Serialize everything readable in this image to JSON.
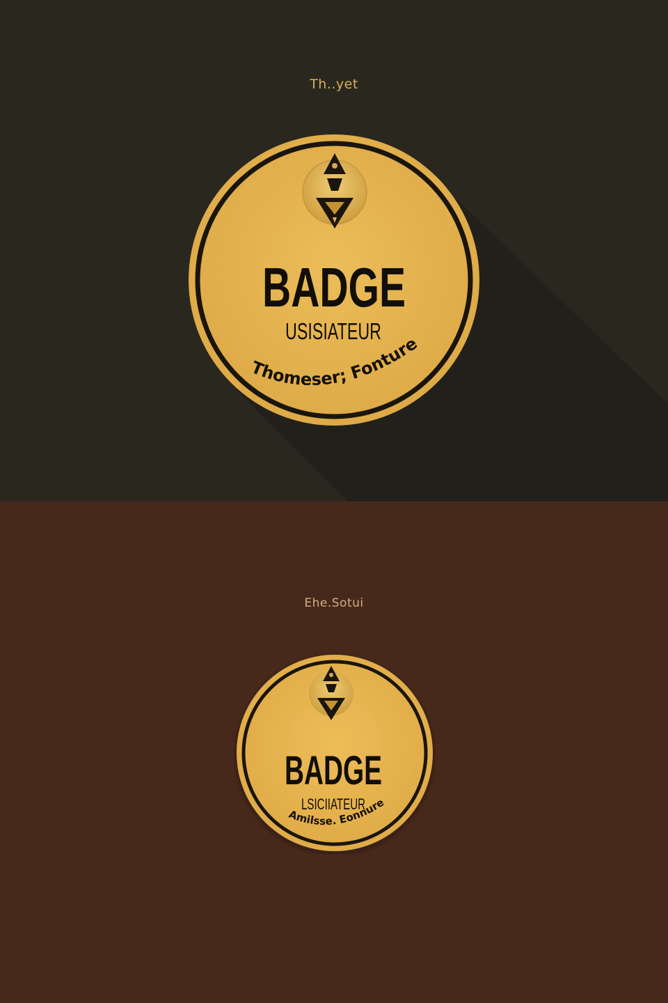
{
  "top_panel": {
    "caption": "Th..yet",
    "badge": {
      "title": "BADGE",
      "subtitle": "USISIATEUR",
      "arc_text": "Thomeser; Fonture",
      "emblem_icon": "fox-crest-icon"
    }
  },
  "bottom_panel": {
    "caption": "Ehe.Sotui",
    "badge": {
      "title": "BADGE",
      "subtitle": "LSICIIATEUR",
      "arc_text": "Amilsse. Eonnure",
      "emblem_icon": "fox-crest-icon"
    }
  },
  "colors": {
    "top_background": "#2a271e",
    "bottom_background": "#47291b",
    "badge_gold": "#e3b24d",
    "badge_ring": "#1a150d",
    "caption_gold": "#d9b15a"
  }
}
